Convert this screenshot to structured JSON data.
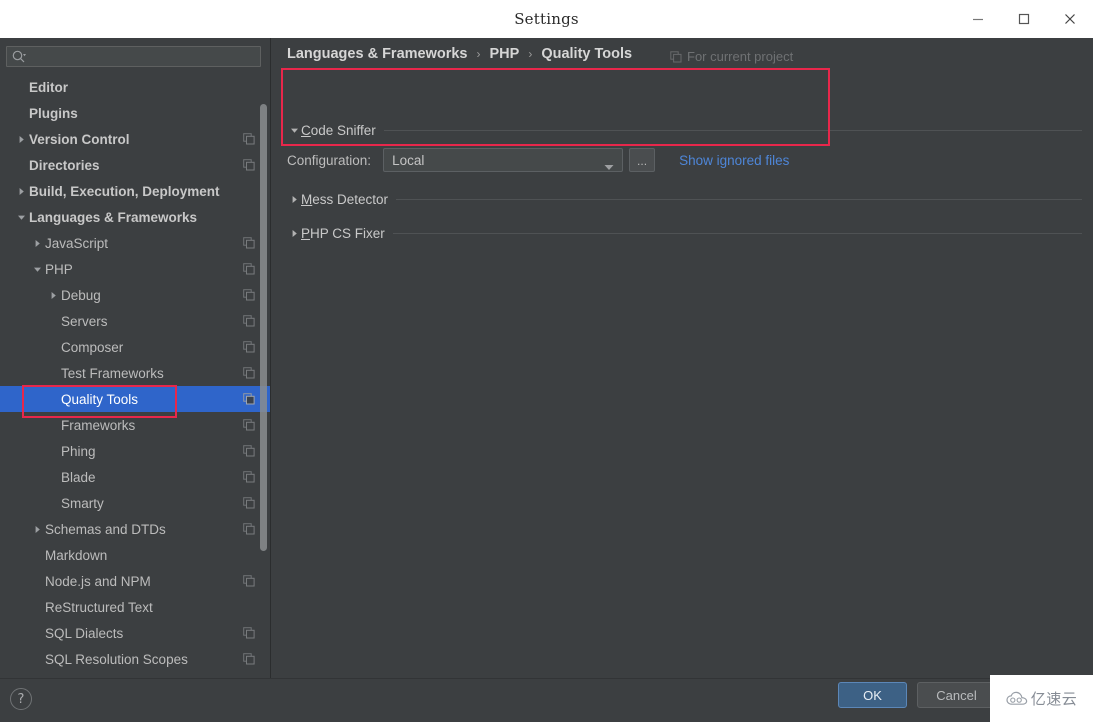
{
  "window": {
    "title": "Settings",
    "minimize_label": "minimize",
    "maximize_label": "maximize",
    "close_label": "close"
  },
  "sidebar": {
    "search": {
      "value": "",
      "placeholder": ""
    },
    "items": [
      {
        "label": "Editor",
        "level": 0,
        "arrow": "none",
        "copy": false,
        "selected": false
      },
      {
        "label": "Plugins",
        "level": 0,
        "arrow": "none",
        "copy": false,
        "selected": false
      },
      {
        "label": "Version Control",
        "level": 0,
        "arrow": "collapsed",
        "copy": true,
        "selected": false
      },
      {
        "label": "Directories",
        "level": 0,
        "arrow": "none",
        "copy": true,
        "selected": false
      },
      {
        "label": "Build, Execution, Deployment",
        "level": 0,
        "arrow": "collapsed",
        "copy": false,
        "selected": false
      },
      {
        "label": "Languages & Frameworks",
        "level": 0,
        "arrow": "expanded",
        "copy": false,
        "selected": false
      },
      {
        "label": "JavaScript",
        "level": 1,
        "arrow": "collapsed",
        "copy": true,
        "selected": false
      },
      {
        "label": "PHP",
        "level": 1,
        "arrow": "expanded",
        "copy": true,
        "selected": false
      },
      {
        "label": "Debug",
        "level": 2,
        "arrow": "collapsed",
        "copy": true,
        "selected": false
      },
      {
        "label": "Servers",
        "level": 2,
        "arrow": "none",
        "copy": true,
        "selected": false
      },
      {
        "label": "Composer",
        "level": 2,
        "arrow": "none",
        "copy": true,
        "selected": false
      },
      {
        "label": "Test Frameworks",
        "level": 2,
        "arrow": "none",
        "copy": true,
        "selected": false
      },
      {
        "label": "Quality Tools",
        "level": 2,
        "arrow": "none",
        "copy": true,
        "selected": true
      },
      {
        "label": "Frameworks",
        "level": 2,
        "arrow": "none",
        "copy": true,
        "selected": false
      },
      {
        "label": "Phing",
        "level": 2,
        "arrow": "none",
        "copy": true,
        "selected": false
      },
      {
        "label": "Blade",
        "level": 2,
        "arrow": "none",
        "copy": true,
        "selected": false
      },
      {
        "label": "Smarty",
        "level": 2,
        "arrow": "none",
        "copy": true,
        "selected": false
      },
      {
        "label": "Schemas and DTDs",
        "level": 1,
        "arrow": "collapsed",
        "copy": true,
        "selected": false
      },
      {
        "label": "Markdown",
        "level": 1,
        "arrow": "none",
        "copy": false,
        "selected": false
      },
      {
        "label": "Node.js and NPM",
        "level": 1,
        "arrow": "none",
        "copy": true,
        "selected": false
      },
      {
        "label": "ReStructured Text",
        "level": 1,
        "arrow": "none",
        "copy": false,
        "selected": false
      },
      {
        "label": "SQL Dialects",
        "level": 1,
        "arrow": "none",
        "copy": true,
        "selected": false
      },
      {
        "label": "SQL Resolution Scopes",
        "level": 1,
        "arrow": "none",
        "copy": true,
        "selected": false
      }
    ]
  },
  "main": {
    "breadcrumb": [
      "Languages & Frameworks",
      "PHP",
      "Quality Tools"
    ],
    "breadcrumb_separator": "›",
    "for_current_project": "For current project",
    "sections": [
      {
        "title": "Code Sniffer",
        "mnemonic": "C",
        "rest": "ode Sniffer",
        "expanded": true
      },
      {
        "title": "Mess Detector",
        "mnemonic": "M",
        "rest": "ess Detector",
        "expanded": false
      },
      {
        "title": "PHP CS Fixer",
        "mnemonic": "P",
        "rest": "HP CS Fixer",
        "expanded": false
      }
    ],
    "code_sniffer": {
      "configuration_label": "Configuration:",
      "configuration_value": "Local",
      "browse_label": "...",
      "show_ignored_files": "Show ignored files"
    }
  },
  "footer": {
    "help_label": "?",
    "ok_label": "OK",
    "cancel_label": "Cancel"
  },
  "watermark": {
    "text": "亿速云"
  },
  "colors": {
    "accent_selection": "#2f65ca",
    "annotation_red": "#e8274b",
    "link_blue": "#4e86d8",
    "panel_bg": "#3c3f41",
    "ok_button": "#3d6185"
  }
}
